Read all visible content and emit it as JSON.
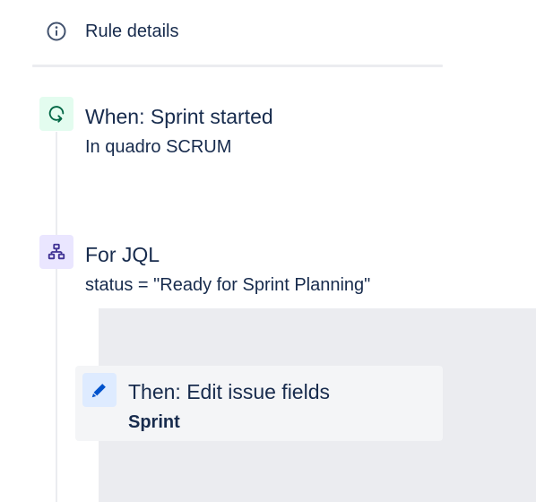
{
  "header": {
    "rule_details_label": "Rule details",
    "icon": "info-icon"
  },
  "trigger": {
    "title": "When: Sprint started",
    "subtitle": "In quadro SCRUM",
    "icon": "sprint-trigger-icon",
    "icon_color": "#006644",
    "icon_bg": "#e3fcef"
  },
  "branch": {
    "title": "For JQL",
    "subtitle": "status = \"Ready for Sprint Planning\"",
    "icon": "branch-icon",
    "icon_color": "#403294",
    "icon_bg": "#eae6ff"
  },
  "action": {
    "title": "Then: Edit issue fields",
    "subtitle": "Sprint",
    "icon": "pencil-icon",
    "icon_color": "#0052cc",
    "icon_bg": "#deebff"
  }
}
